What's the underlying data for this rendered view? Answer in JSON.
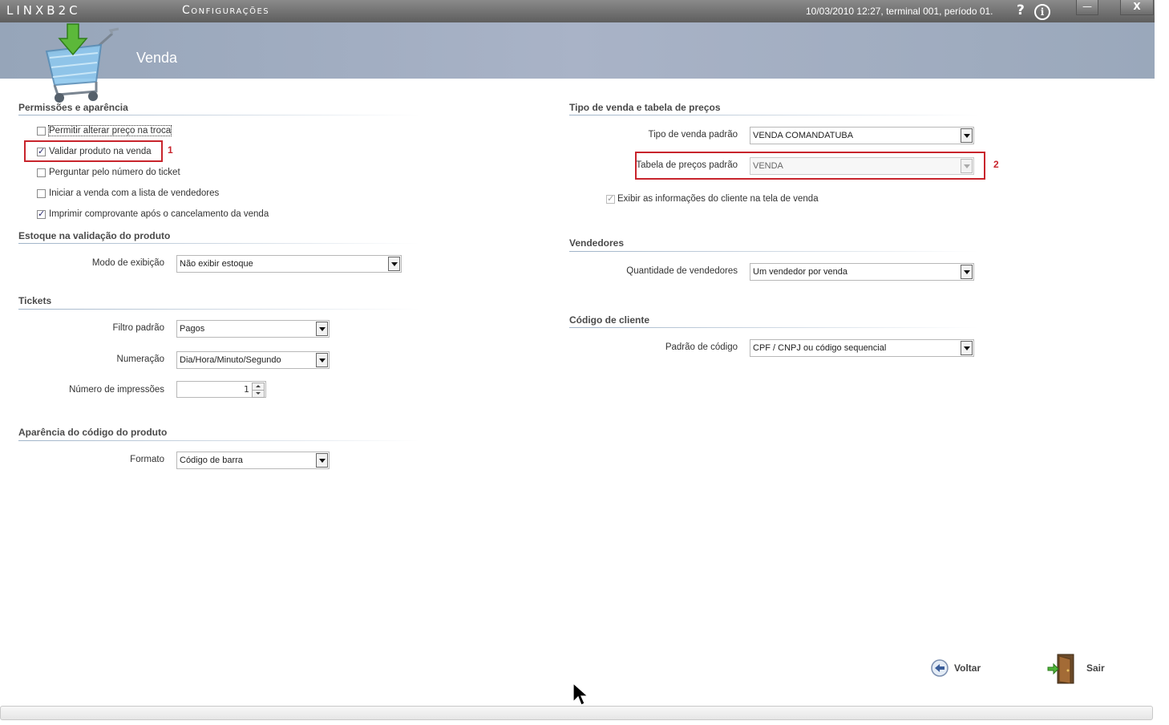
{
  "titlebar": {
    "brand": "LINXB2C",
    "module": "Configurações",
    "status": "10/03/2010 12:27, terminal 001, período 01.",
    "help": "?",
    "info": "i",
    "minimize": "—",
    "close": "X"
  },
  "header": {
    "title": "Venda"
  },
  "left": {
    "perm": {
      "title": "Permissões e aparência",
      "items": [
        {
          "label": "Permitir alterar preço na troca",
          "checked": false
        },
        {
          "label": "Validar produto na venda",
          "checked": true
        },
        {
          "label": "Perguntar pelo número do ticket",
          "checked": false
        },
        {
          "label": "Iniciar a venda com a lista de vendedores",
          "checked": false
        },
        {
          "label": "Imprimir comprovante após o cancelamento da venda",
          "checked": true
        }
      ]
    },
    "estoque": {
      "title": "Estoque na validação do produto",
      "modo_label": "Modo de exibição",
      "modo_value": "Não exibir estoque"
    },
    "tickets": {
      "title": "Tickets",
      "filtro_label": "Filtro padrão",
      "filtro_value": "Pagos",
      "numeracao_label": "Numeração",
      "numeracao_value": "Dia/Hora/Minuto/Segundo",
      "impressoes_label": "Número de impressões",
      "impressoes_value": "1"
    },
    "aparencia": {
      "title": "Aparência do código do produto",
      "formato_label": "Formato",
      "formato_value": "Código de barra"
    }
  },
  "right": {
    "tipo": {
      "title": "Tipo de venda e tabela de preços",
      "tipo_label": "Tipo de venda padrão",
      "tipo_value": "VENDA COMANDATUBA",
      "tabela_label": "Tabela de preços padrão",
      "tabela_value": "VENDA",
      "exibir_label": "Exibir as informações do cliente na tela de venda",
      "exibir_checked": true
    },
    "vendedores": {
      "title": "Vendedores",
      "qtd_label": "Quantidade de vendedores",
      "qtd_value": "Um vendedor por venda"
    },
    "codigo": {
      "title": "Código de cliente",
      "padrao_label": "Padrão de código",
      "padrao_value": "CPF / CNPJ ou código sequencial"
    }
  },
  "annotations": {
    "one": "1",
    "two": "2",
    "color": "#c8242c"
  },
  "actions": {
    "voltar": "Voltar",
    "sair": "Sair"
  }
}
